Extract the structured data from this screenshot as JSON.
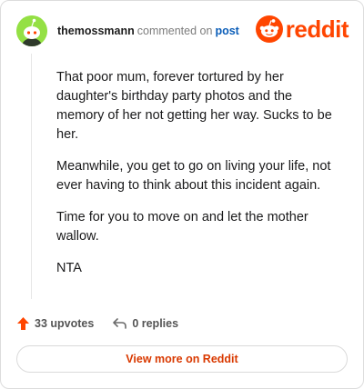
{
  "comment": {
    "username": "themossmann",
    "action_text": "commented on",
    "post_link": "post",
    "paragraphs": [
      "That poor mum, forever tortured by her daughter's birthday party photos and the memory of her not getting her way. Sucks to be her.",
      "Meanwhile, you get to go on living your life, not ever having to think about this incident again.",
      "Time for you to move on and let the mother wallow.",
      "NTA"
    ]
  },
  "brand": {
    "wordmark": "reddit",
    "color": "#ff4500"
  },
  "footer": {
    "upvotes": "33 upvotes",
    "replies": "0 replies"
  },
  "cta": {
    "label": "View more on Reddit"
  },
  "icons": {
    "avatar": "snoo-avatar-icon",
    "logo": "reddit-logo-icon",
    "upvote": "upvote-arrow-icon",
    "reply": "reply-arrow-icon"
  }
}
